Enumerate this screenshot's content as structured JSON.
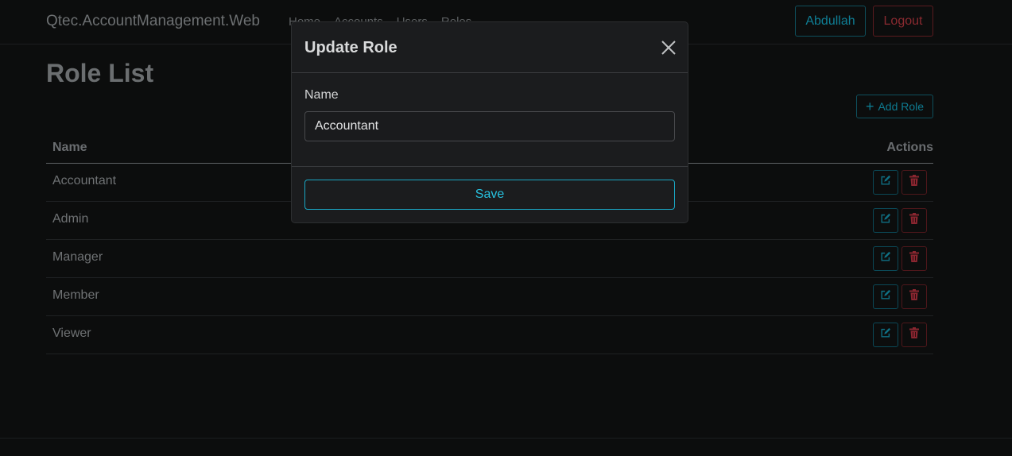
{
  "navbar": {
    "brand": "Qtec.AccountManagement.Web",
    "links": [
      "Home",
      "Accounts",
      "Users",
      "Roles"
    ],
    "user_label": "Abdullah",
    "logout_label": "Logout"
  },
  "page": {
    "title": "Role List",
    "add_label": "Add Role"
  },
  "table": {
    "headers": {
      "name": "Name",
      "actions": "Actions"
    },
    "rows": [
      {
        "name": "Accountant"
      },
      {
        "name": "Admin"
      },
      {
        "name": "Manager"
      },
      {
        "name": "Member"
      },
      {
        "name": "Viewer"
      }
    ]
  },
  "modal": {
    "title": "Update Role",
    "name_label": "Name",
    "name_value": "Accountant",
    "save_label": "Save"
  },
  "colors": {
    "info": "#0dcaf0",
    "danger": "#dc3545",
    "background": "#0c0d0d",
    "modal": "#1b1c1e"
  },
  "icons": {
    "add": "plus-icon",
    "edit": "edit-icon",
    "delete": "trash-icon",
    "close": "close-icon"
  }
}
